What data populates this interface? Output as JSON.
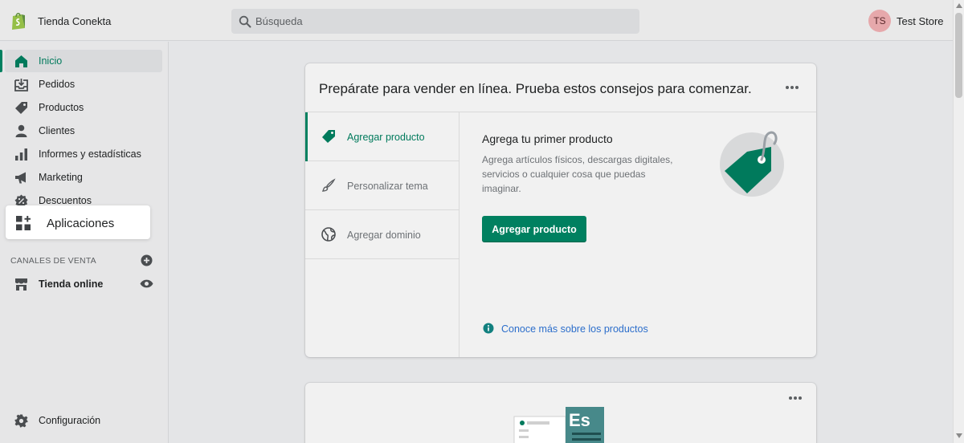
{
  "header": {
    "store_name": "Tienda Conekta",
    "search_placeholder": "Búsqueda",
    "user_initials": "TS",
    "user_name": "Test Store"
  },
  "sidebar": {
    "items": [
      {
        "label": "Inicio",
        "icon": "home-icon",
        "active": true
      },
      {
        "label": "Pedidos",
        "icon": "orders-icon"
      },
      {
        "label": "Productos",
        "icon": "tag-icon"
      },
      {
        "label": "Clientes",
        "icon": "person-icon"
      },
      {
        "label": "Informes y estadísticas",
        "icon": "bar-chart-icon"
      },
      {
        "label": "Marketing",
        "icon": "megaphone-icon"
      },
      {
        "label": "Descuentos",
        "icon": "discount-icon"
      },
      {
        "label": "Aplicaciones",
        "icon": "apps-icon",
        "highlighted": true
      }
    ],
    "sales_channels_heading": "CANALES DE VENTA",
    "channels": [
      {
        "label": "Tienda online",
        "icon": "store-icon"
      }
    ],
    "settings_label": "Configuración"
  },
  "main": {
    "card_title": "Prepárate para vender en línea. Prueba estos consejos para comenzar.",
    "tabs": [
      {
        "label": "Agregar producto",
        "icon": "tag-icon",
        "active": true
      },
      {
        "label": "Personalizar tema",
        "icon": "brush-icon"
      },
      {
        "label": "Agregar dominio",
        "icon": "globe-icon"
      }
    ],
    "content": {
      "heading": "Agrega tu primer producto",
      "description": "Agrega artículos físicos, descargas digitales, servicios o cualquier cosa que puedas imaginar.",
      "button_label": "Agregar producto",
      "learn_more": "Conoce más sobre los productos"
    },
    "second_card_badge": "Es"
  },
  "colors": {
    "accent": "#008060",
    "link": "#2c6ecb",
    "avatar": "#e6a8ab"
  }
}
